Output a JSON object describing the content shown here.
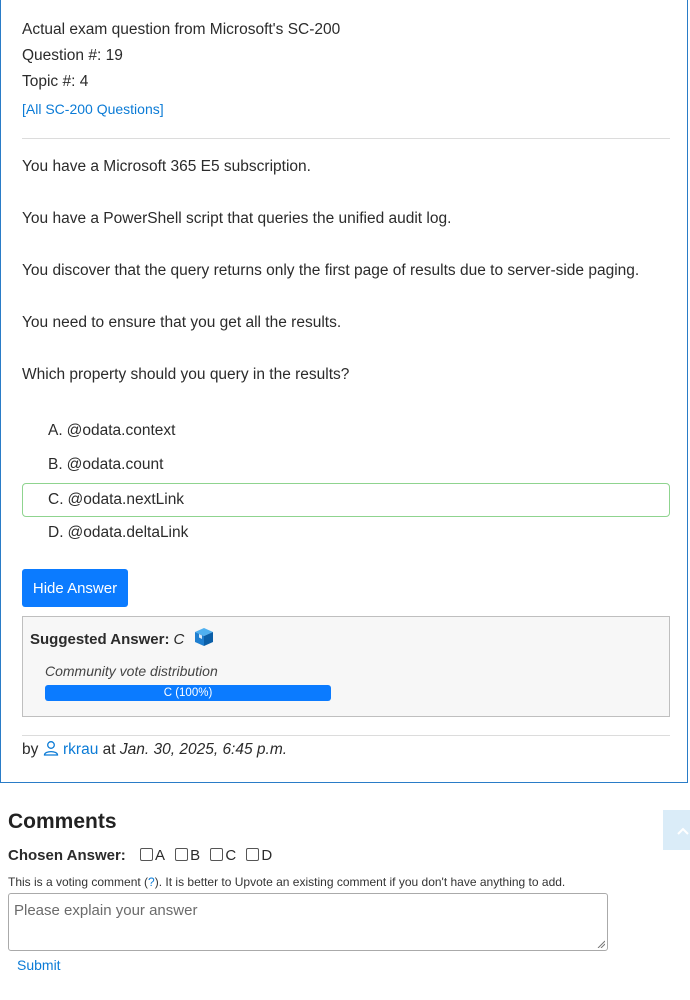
{
  "header": {
    "line1": "Actual exam question from Microsoft's SC-200",
    "question_no": "Question #: 19",
    "topic_no": "Topic #: 4",
    "all_questions_link": "[All SC-200 Questions]"
  },
  "question": {
    "paragraphs": [
      "You have a Microsoft 365 E5 subscription.",
      "You have a PowerShell script that queries the unified audit log.",
      "You discover that the query returns only the first page of results due to server-side paging.",
      "You need to ensure that you get all the results.",
      "Which property should you query in the results?"
    ],
    "choices": [
      {
        "letter": "A.",
        "text": "@odata.context"
      },
      {
        "letter": "B.",
        "text": "@odata.count"
      },
      {
        "letter": "C.",
        "text": "@odata.nextLink"
      },
      {
        "letter": "D.",
        "text": "@odata.deltaLink"
      }
    ],
    "correct_index": 2
  },
  "hide_answer_label": "Hide Answer",
  "answer": {
    "suggested_label": "Suggested Answer:",
    "suggested_value": "C",
    "vote_title": "Community vote distribution",
    "vote_bar_label": "C (100%)",
    "vote_percent": 100
  },
  "author": {
    "by": "by",
    "user": "rkrau",
    "at": "at",
    "date": "Jan. 30, 2025, 6:45 p.m."
  },
  "comments": {
    "heading": "Comments",
    "chosen_label": "Chosen Answer:",
    "options": [
      "A",
      "B",
      "C",
      "D"
    ],
    "note_before": "This is a voting comment (",
    "note_link": "?",
    "note_after": "). It is better to Upvote an existing comment if you don't have anything to add.",
    "placeholder": "Please explain your answer",
    "submit_label": "Submit"
  },
  "colors": {
    "accent": "#0b7bff",
    "link": "#0b7bd6",
    "correct_border": "#8fd48f"
  }
}
